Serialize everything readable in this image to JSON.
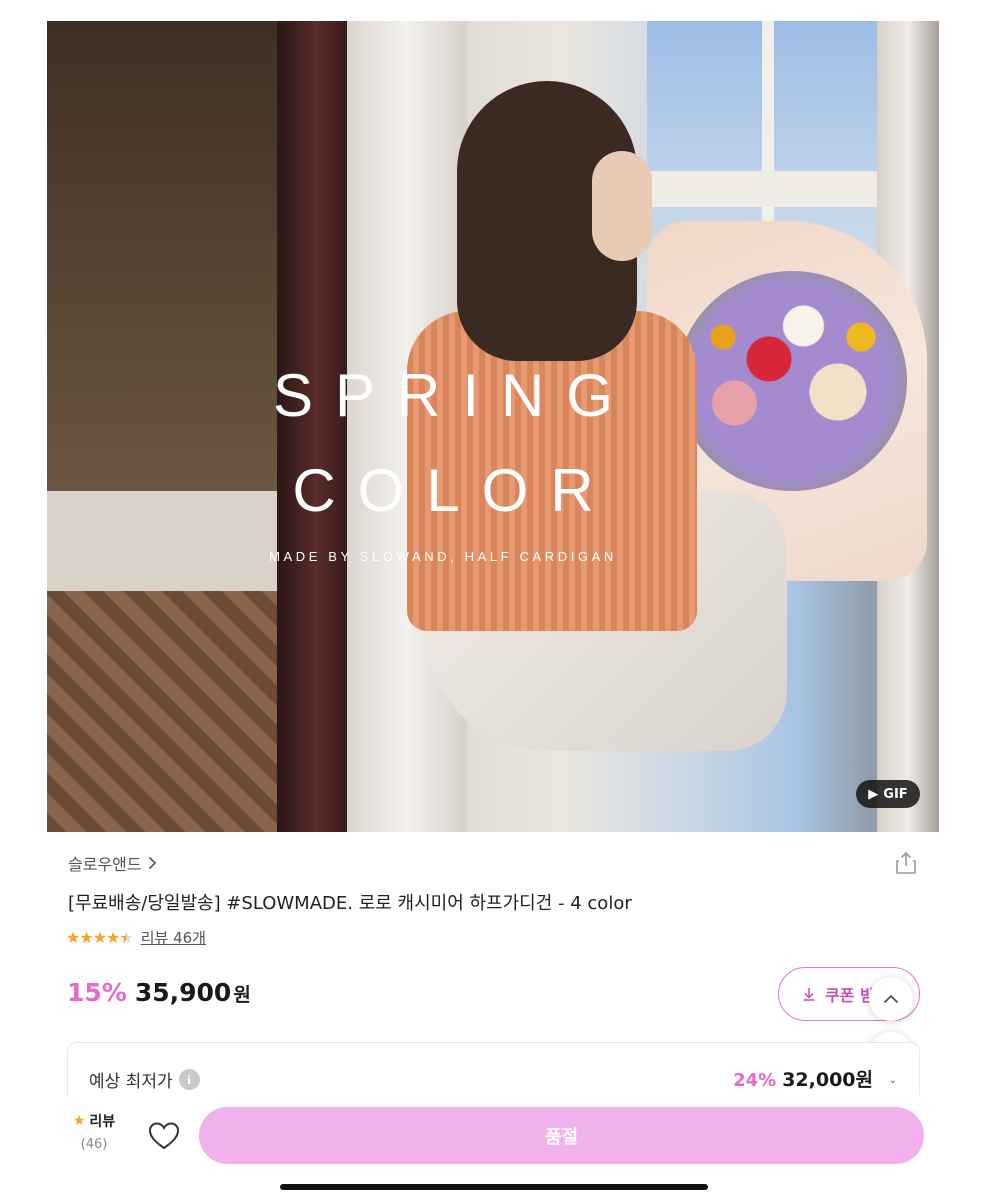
{
  "hero": {
    "line1": "SPRING",
    "line2": "COLOR",
    "line3": "MADE BY SLOWAND, HALF CARDIGAN",
    "gif_badge": "GIF"
  },
  "product": {
    "brand": "슬로우앤드",
    "title": "[무료배송/당일발송] #SLOWMADE. 로로 캐시미어 하프가디건 - 4 color",
    "rating": 4.5,
    "review_link": "리뷰 46개",
    "discount": "15%",
    "price": "35,900",
    "currency": "원",
    "coupon_label": "쿠폰 받"
  },
  "lowest": {
    "label": "예상 최저가",
    "info": "i",
    "discount": "24%",
    "price": "32,000원"
  },
  "bottom_bar": {
    "review_label": "리뷰",
    "review_count": "(46)",
    "soldout_label": "품절"
  },
  "colors": {
    "accent": "#e969c8",
    "soldout_button": "#f0b1ec",
    "star": "#f5a623"
  }
}
